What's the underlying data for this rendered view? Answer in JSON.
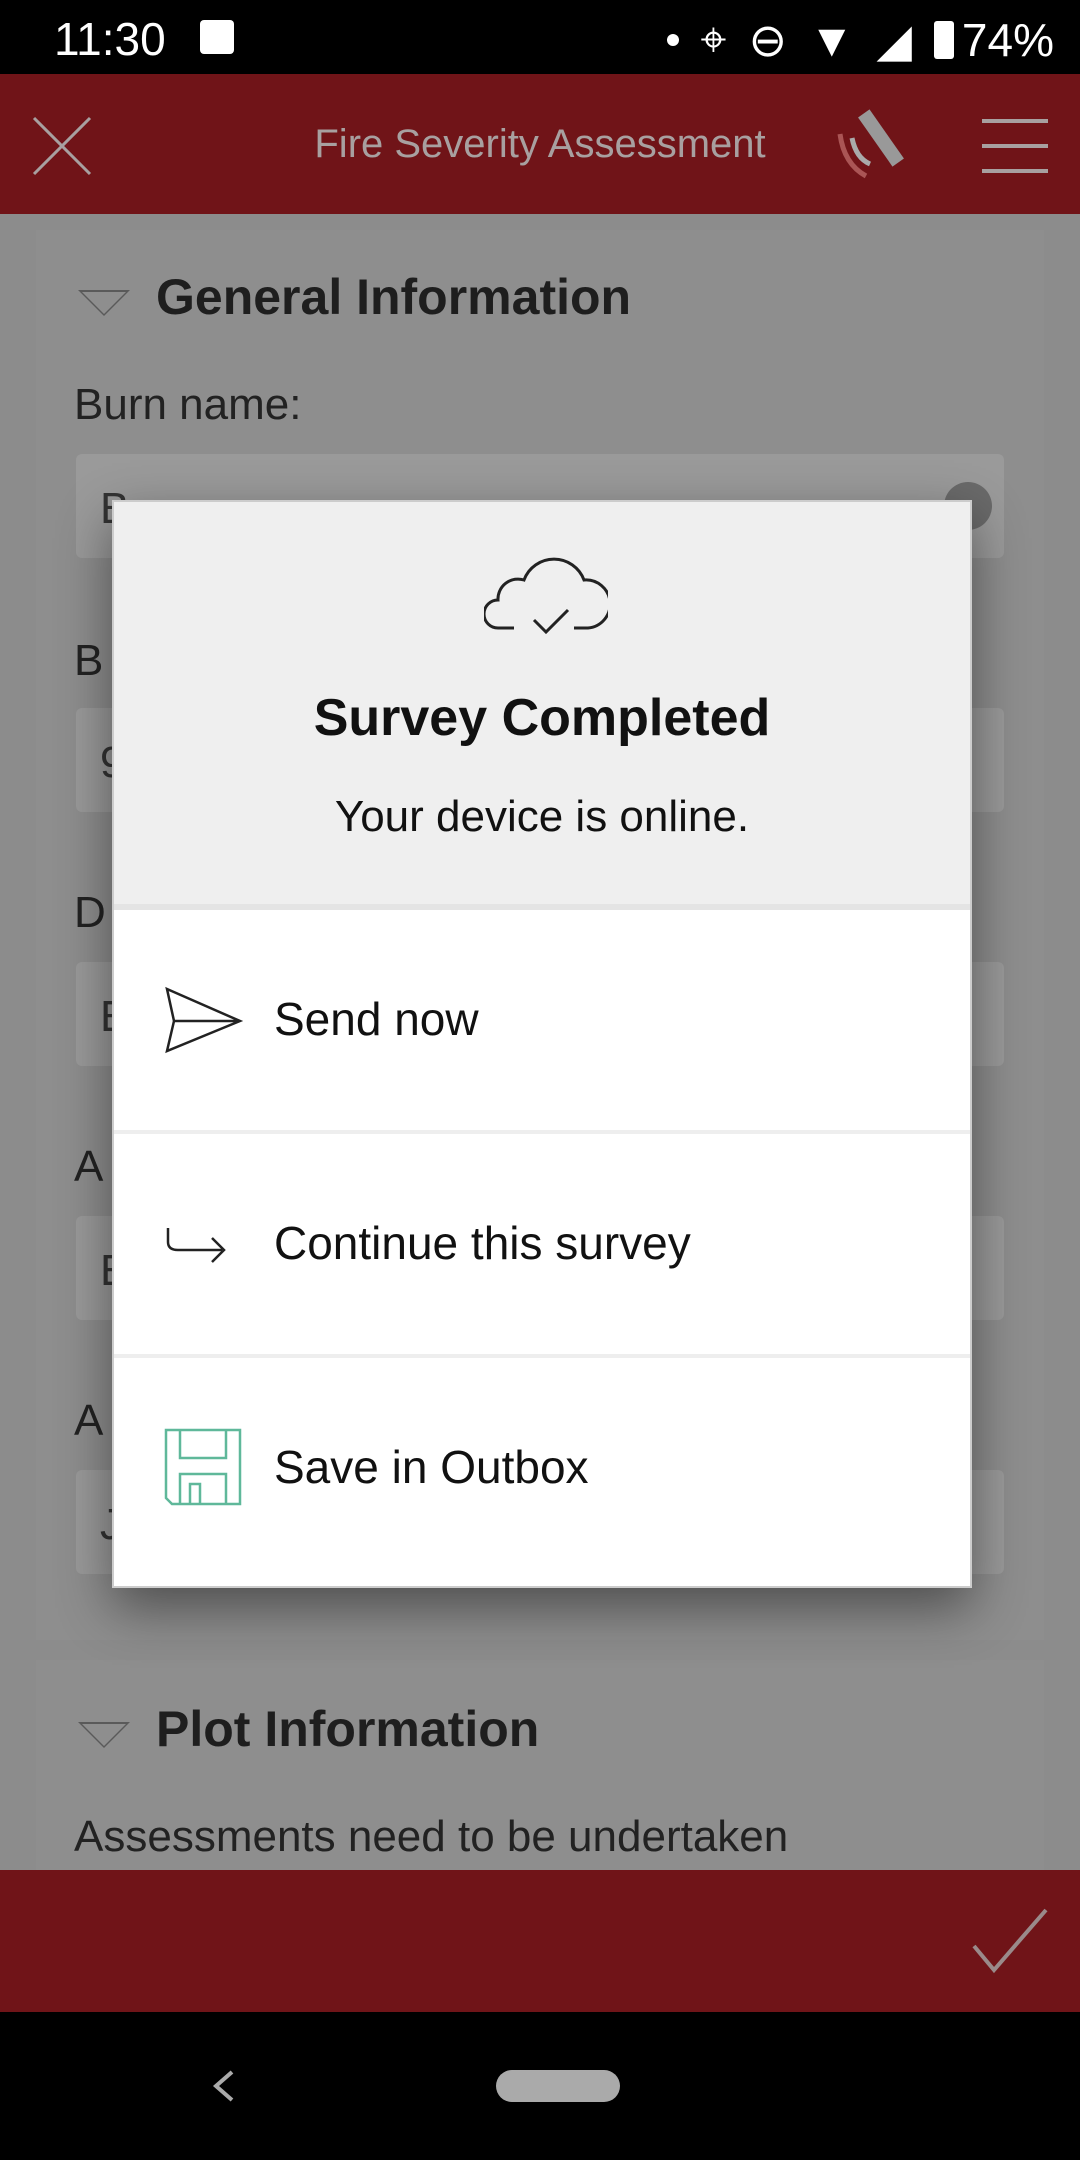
{
  "status_bar": {
    "time": "11:30",
    "battery": "74%",
    "icons": [
      "image-icon",
      "dot-icon",
      "location-icon",
      "dnd-icon",
      "wifi-icon",
      "signal-icon",
      "battery-icon"
    ]
  },
  "app_bar": {
    "title": "Fire Severity Assessment",
    "icons": [
      "close-icon",
      "gps-satellite-icon",
      "menu-icon"
    ]
  },
  "form": {
    "section1": {
      "title": "General Information",
      "burn_name_label": "Burn name:",
      "fields": [
        {
          "label": "",
          "value": "B"
        },
        {
          "label": "B",
          "value": "9"
        },
        {
          "label": "D",
          "value": "E"
        },
        {
          "label": "A",
          "value": "E"
        },
        {
          "label": "A",
          "value": "J"
        }
      ]
    },
    "section2": {
      "title": "Plot Information",
      "text": "Assessments need to be undertaken"
    }
  },
  "dialog": {
    "icon": "cloud-check-icon",
    "title": "Survey Completed",
    "subtitle": "Your device is online.",
    "actions": [
      {
        "label": "Send now",
        "icon": "paper-plane-icon"
      },
      {
        "label": "Continue this survey",
        "icon": "arrow-return-icon"
      },
      {
        "label": "Save in Outbox",
        "icon": "floppy-disk-icon",
        "icon_color": "#5fb89a"
      }
    ]
  },
  "colors": {
    "brand": "#701418"
  }
}
